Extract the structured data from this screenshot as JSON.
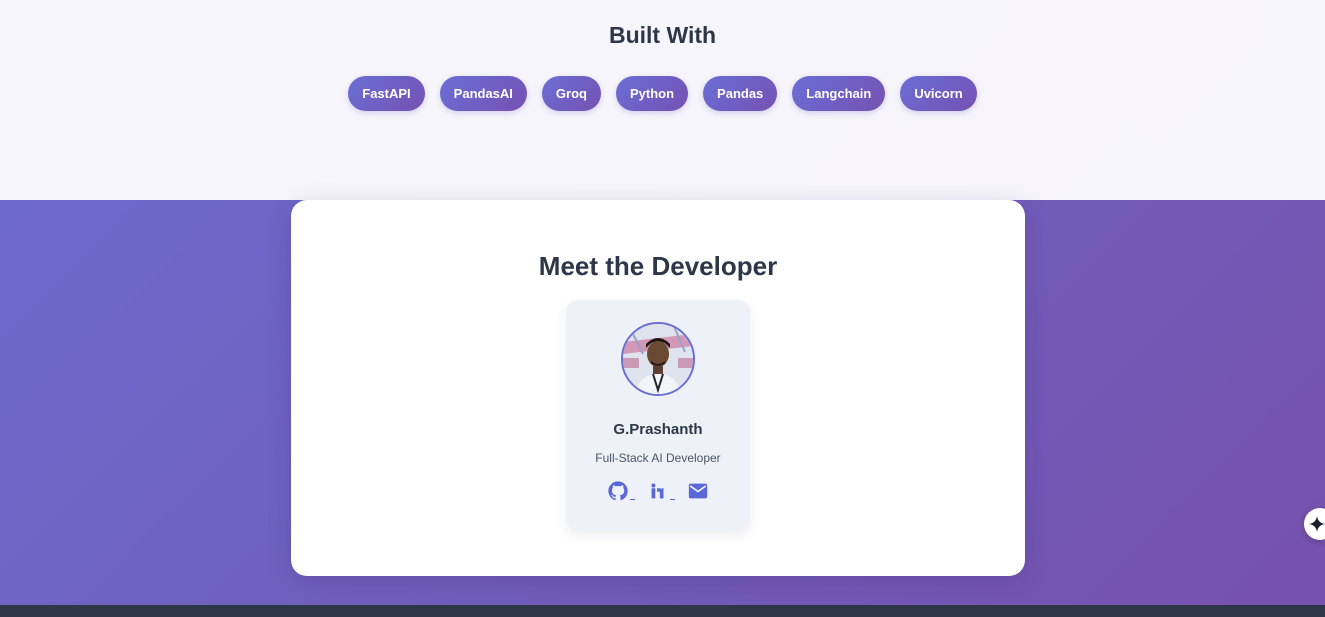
{
  "built_with": {
    "title": "Built With",
    "technologies": [
      "FastAPI",
      "PandasAI",
      "Groq",
      "Python",
      "Pandas",
      "Langchain",
      "Uvicorn"
    ]
  },
  "developer_section": {
    "title": "Meet the Developer",
    "profile": {
      "name": "G.Prashanth",
      "role": "Full-Stack AI Developer",
      "avatar_icon": "developer-photo",
      "social_links": [
        {
          "icon": "github-icon"
        },
        {
          "icon": "linkedin-icon"
        },
        {
          "icon": "email-icon"
        }
      ]
    }
  },
  "floating_button": {
    "icon": "sparkle-icon"
  },
  "colors": {
    "accent_start": "#6a6fd6",
    "accent_end": "#7650b2",
    "heading": "#2d3748",
    "footer": "#2d3748"
  }
}
